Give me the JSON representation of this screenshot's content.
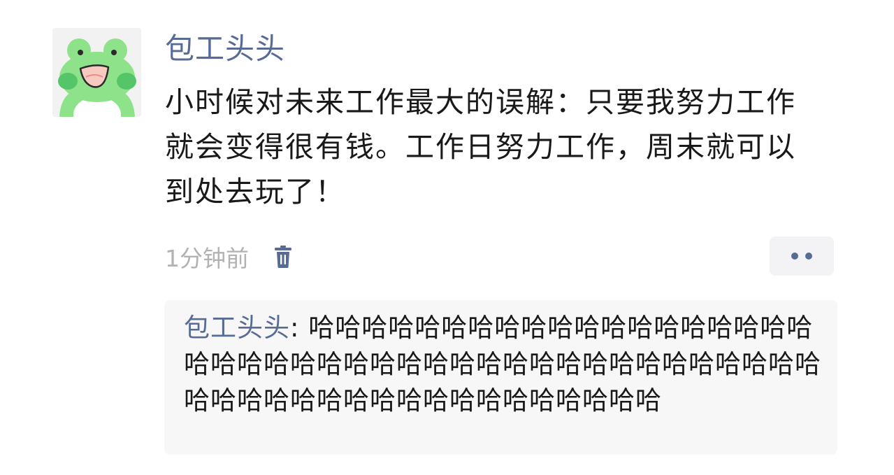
{
  "post": {
    "username": "包工头头",
    "text": "小时候对未来工作最大的误解：只要我努力工作就会变得很有钱。工作日努力工作，周末就可以到处去玩了！",
    "timestamp": "1分钟前",
    "avatar_icon": "frog-avatar-icon",
    "delete_icon": "trash-icon",
    "more_icon": "more-dots-icon"
  },
  "comments": [
    {
      "author": "包工头头",
      "separator": ": ",
      "text": "哈哈哈哈哈哈哈哈哈哈哈哈哈哈哈哈哈哈哈哈哈哈哈哈哈哈哈哈哈哈哈哈哈哈哈哈哈哈哈哈哈哈哈哈哈哈哈哈哈哈哈哈哈哈哈哈哈哈哈哈哈"
    }
  ],
  "colors": {
    "link": "#576b95",
    "text": "#191919",
    "muted": "#b2b2b2",
    "comment_bg": "#f7f7f7",
    "frog_green": "#8ee38a",
    "cheek": "#55c56a"
  }
}
